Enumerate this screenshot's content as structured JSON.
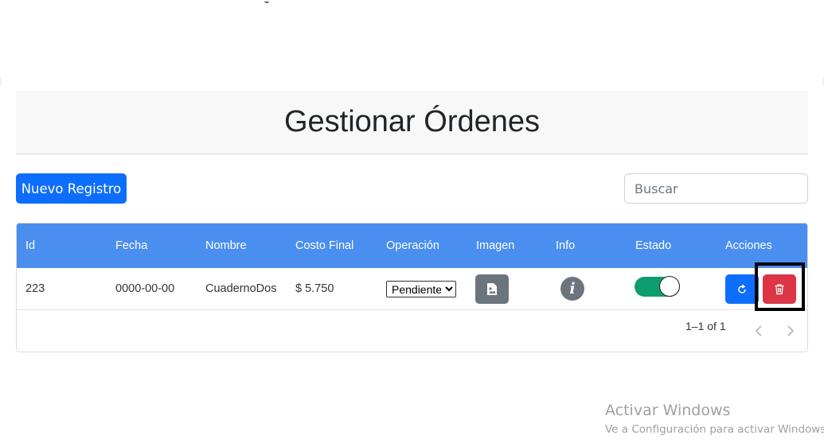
{
  "header": {
    "title": "Gestionar Órdenes"
  },
  "toolbar": {
    "new_button_label": "Nuevo Registro",
    "search_placeholder": "Buscar"
  },
  "table": {
    "columns": [
      "Id",
      "Fecha",
      "Nombre",
      "Costo Final",
      "Operación",
      "Imagen",
      "Info",
      "Estado",
      "Acciones"
    ],
    "rows": [
      {
        "id": "223",
        "fecha": "0000-00-00",
        "nombre": "CuadernoDos",
        "costo_final": "$ 5.750",
        "operacion": "Pendiente",
        "imagen_icon": "image-file-icon",
        "info_icon": "info-icon",
        "estado_on": true,
        "acciones": [
          "refresh-icon",
          "trash-icon"
        ]
      }
    ],
    "operacion_options": [
      "Pendiente"
    ]
  },
  "pagination": {
    "range_text": "1–1 of 1"
  },
  "watermark": {
    "title": "Activar Windows",
    "subtitle": "Ve a Configuración para activar Windows."
  },
  "colors": {
    "primary": "#0d6efd",
    "header_bg": "#4a8ef0",
    "danger": "#dc3545",
    "secondary": "#6c757d",
    "toggle_on": "#0e9d6e"
  }
}
